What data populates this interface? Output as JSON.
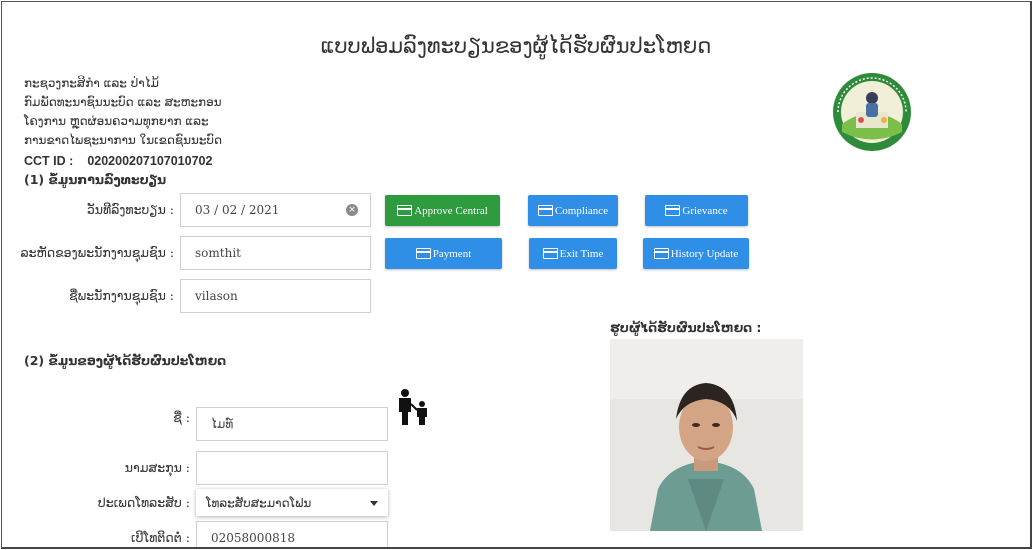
{
  "page": {
    "title": "ແບບຟອມລົງທະບຽນຂອງຜູ້ໄດ້ຮັບຜົນປະໂຫຍດ",
    "ministry_lines": [
      "ກະຊວງກະສິກຳ ແລະ ປ່າໄມ້",
      "ກົມພັດທະນາຊົນນະບົດ ແລະ ສະຫະກອນ",
      "ໂຄງການ ຫຼຸດຜ່ອນຄວາມທຸກຍາກ ແລະ",
      "ການຂາດໄພຊະນາການ ໃນເຂດຊົນນະບົດ"
    ],
    "cct_label": "CCT ID :",
    "cct_value": "020200207107010702"
  },
  "section1": {
    "heading": "(1) ຂໍ້ມູນການລົງທະບຽນ",
    "reg_date_label": "ວັນທີລົງທະບຽນ :",
    "reg_date_value": "03 / 02 / 2021",
    "staff_code_label": "ລະຫັດຂອງພະນັກງານຊຸມຊົນ :",
    "staff_code_value": "somthit",
    "staff_name_label": "ຊື່ພະນັກງານຊຸມຊົນ :",
    "staff_name_value": "vilason"
  },
  "buttons": {
    "approve": "Approve Central",
    "compliance": "Compliance",
    "grievance": "Grievance",
    "payment": "Payment",
    "exit_time": "Exit Time",
    "history_update": "History Update"
  },
  "section2": {
    "heading": "(2) ຂໍ້ມູນຂອງຜູ້ໄດ້ຮັບຜົນປະໂຫຍດ",
    "name_label": "ຊື່ :",
    "name_value": "ໄມທ໌",
    "surname_label": "ນາມສະກຸນ :",
    "surname_value": "",
    "phone_type_label": "ປະເພດໂທລະສັບ :",
    "phone_type_value": "ໂທລະສັບສະມາດໂຟນ",
    "phone_label": "ເບີໂທຕິດຕໍ່ :",
    "phone_value": "02058000818"
  },
  "photo": {
    "label": "ຮູບຜູ້ໄດ້ຮັບຜົນປະໂຫຍດ :"
  },
  "colors": {
    "approve_green": "#2e9b3e",
    "action_blue": "#2f8fe6"
  },
  "icons": {
    "family": "parent-child-icon",
    "card": "card-icon",
    "clear": "clear-icon",
    "logo": "project-logo"
  }
}
